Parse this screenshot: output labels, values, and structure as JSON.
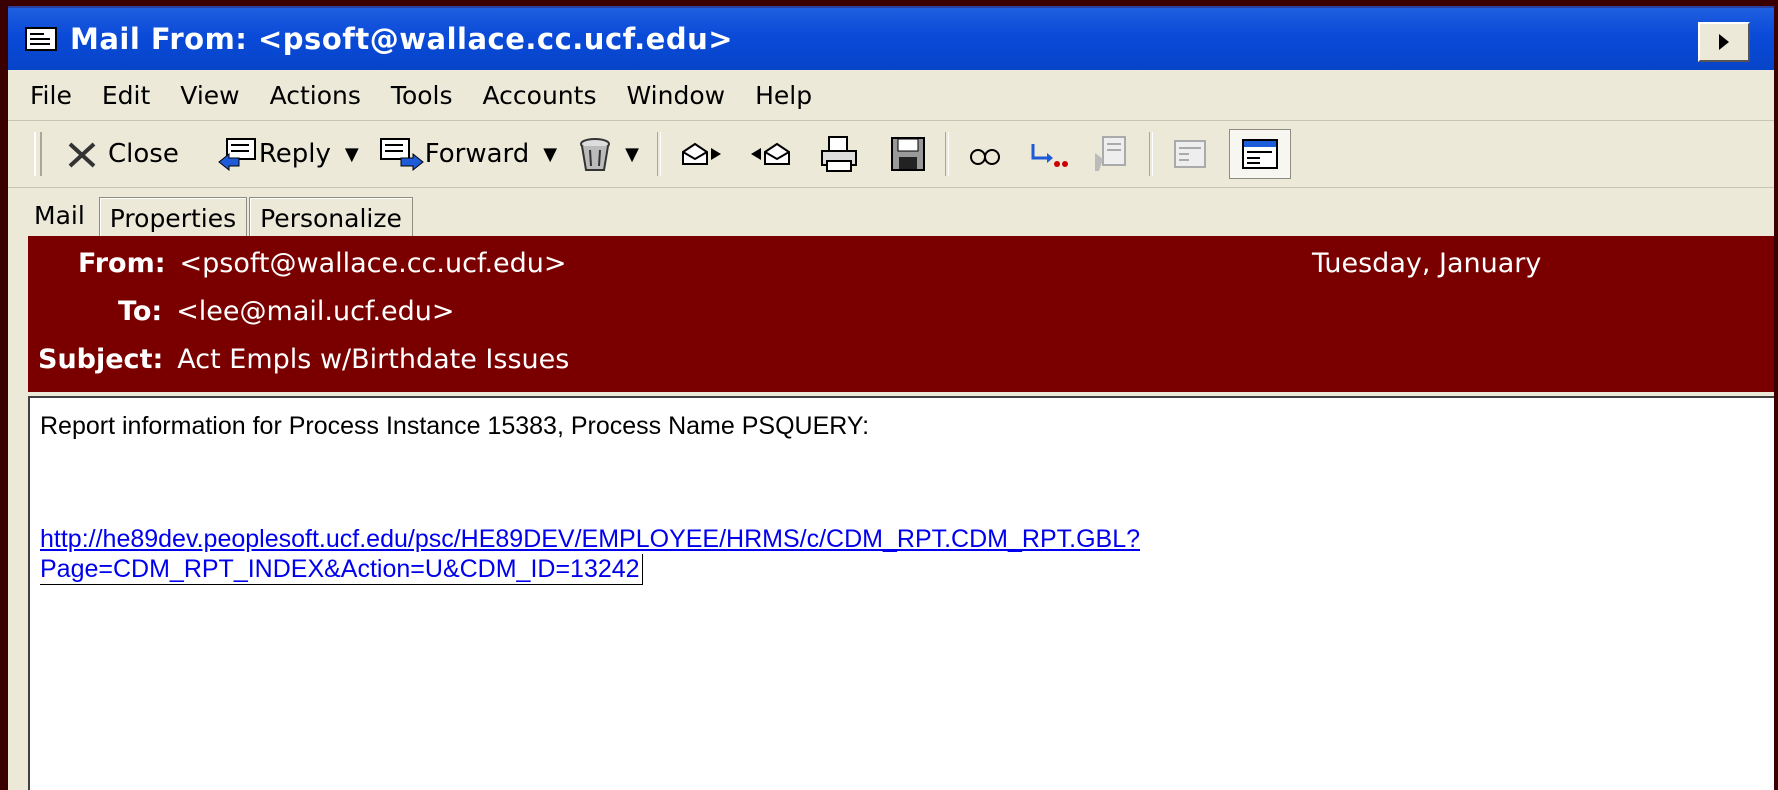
{
  "window": {
    "title": "Mail From: <psoft@wallace.cc.ucf.edu>"
  },
  "menu": [
    "File",
    "Edit",
    "View",
    "Actions",
    "Tools",
    "Accounts",
    "Window",
    "Help"
  ],
  "toolbar": {
    "close_label": "Close",
    "reply_label": "Reply",
    "forward_label": "Forward"
  },
  "tabs": [
    "Mail",
    "Properties",
    "Personalize"
  ],
  "header": {
    "from_label": "From:",
    "from_value": "<psoft@wallace.cc.ucf.edu>",
    "to_label": "To:",
    "to_value": "<lee@mail.ucf.edu>",
    "subject_label": "Subject:",
    "subject_value": "Act Empls w/Birthdate Issues",
    "date": "Tuesday, January"
  },
  "body": {
    "line1": "Report information for Process Instance 15383, Process Name PSQUERY:",
    "link_line1": "http://he89dev.peoplesoft.ucf.edu/psc/HE89DEV/EMPLOYEE/HRMS/c/CDM_RPT.CDM_RPT.GBL?",
    "link_line2": "Page=CDM_RPT_INDEX&Action=U&CDM_ID=13242"
  },
  "colors": {
    "titlebar": "#0a4ad8",
    "header_bg": "#7a0000",
    "window_bg": "#ece9d8",
    "link": "#0000ee"
  },
  "icons": [
    "mail-window-icon",
    "expand-arrow-icon",
    "close-x-icon",
    "reply-icon",
    "forward-icon",
    "delete-icon",
    "previous-message-icon",
    "next-message-icon",
    "print-icon",
    "save-icon",
    "find-icon",
    "move-icon",
    "flag-icon",
    "normal-view-icon",
    "preview-pane-icon"
  ]
}
